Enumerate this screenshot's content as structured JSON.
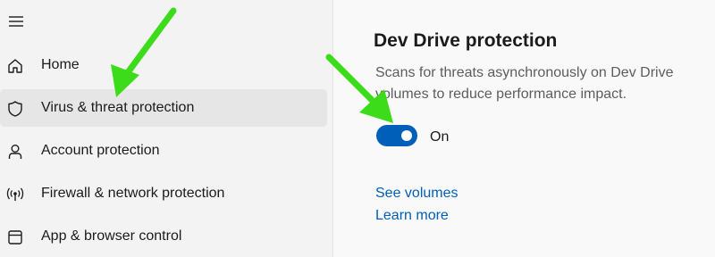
{
  "sidebar": {
    "menu_icon": "hamburger-menu-icon",
    "items": [
      {
        "label": "Home",
        "icon": "home-icon"
      },
      {
        "label": "Virus & threat protection",
        "icon": "shield-icon",
        "selected": true
      },
      {
        "label": "Account protection",
        "icon": "person-icon"
      },
      {
        "label": "Firewall & network protection",
        "icon": "antenna-icon"
      },
      {
        "label": "App & browser control",
        "icon": "app-window-icon"
      }
    ]
  },
  "main": {
    "title": "Dev Drive protection",
    "description": "Scans for threats asynchronously on Dev Drive volumes to reduce performance impact.",
    "toggle": {
      "state": "On",
      "on": true
    },
    "links": {
      "see_volumes": "See volumes",
      "learn_more": "Learn more"
    }
  },
  "colors": {
    "accent": "#005fb8",
    "selected_bg": "#e6e6e6",
    "annotation_arrow": "#3ddc1a"
  }
}
